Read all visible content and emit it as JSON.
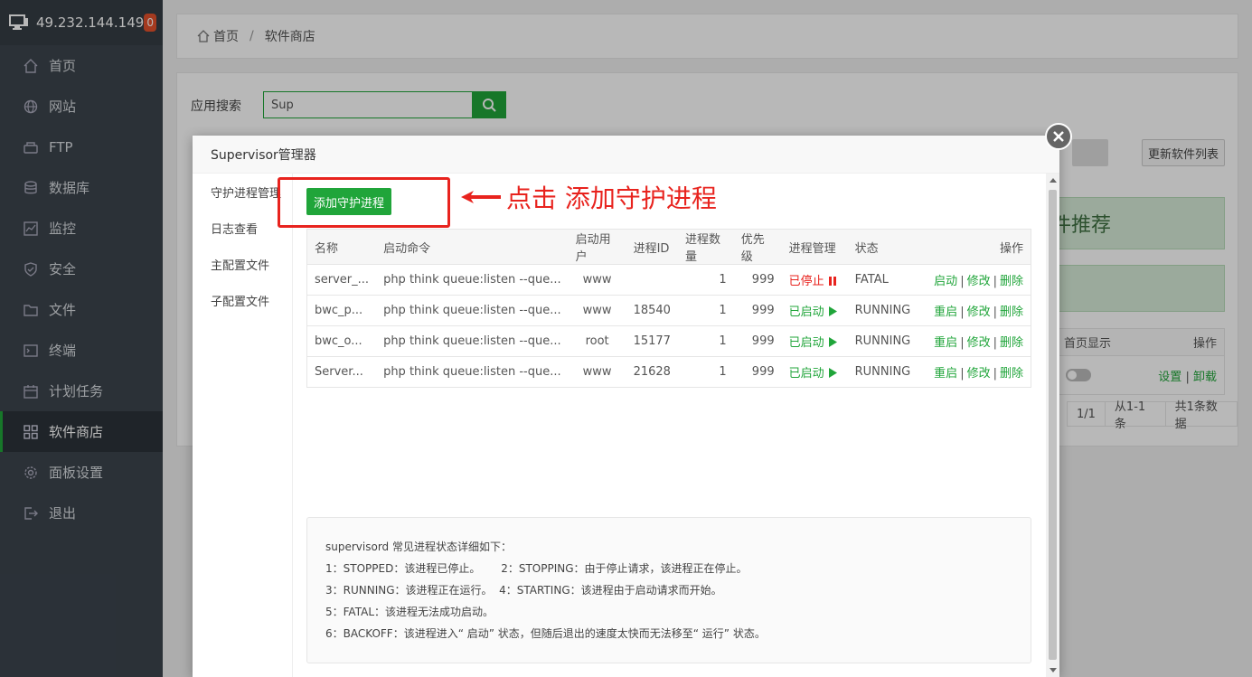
{
  "sidebar": {
    "ip": "49.232.144.149",
    "badge": "0",
    "items": [
      {
        "label": "首页",
        "icon": "home-icon"
      },
      {
        "label": "网站",
        "icon": "globe-icon"
      },
      {
        "label": "FTP",
        "icon": "ftp-icon"
      },
      {
        "label": "数据库",
        "icon": "database-icon"
      },
      {
        "label": "监控",
        "icon": "monitor-chart-icon"
      },
      {
        "label": "安全",
        "icon": "shield-icon"
      },
      {
        "label": "文件",
        "icon": "folder-icon"
      },
      {
        "label": "终端",
        "icon": "terminal-icon"
      },
      {
        "label": "计划任务",
        "icon": "calendar-icon"
      },
      {
        "label": "软件商店",
        "icon": "grid-icon"
      },
      {
        "label": "面板设置",
        "icon": "gear-icon"
      },
      {
        "label": "退出",
        "icon": "logout-icon"
      }
    ],
    "active_index": 9
  },
  "breadcrumb": {
    "home": "首页",
    "separator": "/",
    "current": "软件商店"
  },
  "store": {
    "search_label": "应用搜索",
    "search_value": "Sup",
    "refresh_label": "更新软件列表",
    "recommend_text": "件推荐",
    "table_header_home": "首页显示",
    "table_header_ops": "操作",
    "row_ops_set": "设置",
    "row_ops_uninstall": "卸载",
    "pager_page": "1/1",
    "pager_range": "从1-1条",
    "pager_total": "共1条数据"
  },
  "modal": {
    "title": "Supervisor管理器",
    "tabs": [
      "守护进程管理",
      "日志查看",
      "主配置文件",
      "子配置文件"
    ],
    "add_button": "添加守护进程",
    "annotation": "点击 添加守护进程",
    "columns": [
      "名称",
      "启动命令",
      "启动用户",
      "进程ID",
      "进程数量",
      "优先级",
      "进程管理",
      "状态",
      "操作"
    ],
    "rows": [
      {
        "name": "server_...",
        "cmd": "php think queue:listen --que...",
        "user": "www",
        "pid": "",
        "count": "1",
        "priority": "999",
        "manage": "已停止",
        "manage_state": "stopped",
        "status": "FATAL",
        "op1": "启动",
        "op2": "修改",
        "op3": "删除"
      },
      {
        "name": "bwc_p...",
        "cmd": "php think queue:listen --que...",
        "user": "www",
        "pid": "18540",
        "count": "1",
        "priority": "999",
        "manage": "已启动",
        "manage_state": "started",
        "status": "RUNNING",
        "op1": "重启",
        "op2": "修改",
        "op3": "删除"
      },
      {
        "name": "bwc_o...",
        "cmd": "php think queue:listen --que...",
        "user": "root",
        "pid": "15177",
        "count": "1",
        "priority": "999",
        "manage": "已启动",
        "manage_state": "started",
        "status": "RUNNING",
        "op1": "重启",
        "op2": "修改",
        "op3": "删除"
      },
      {
        "name": "Server...",
        "cmd": "php think queue:listen --que...",
        "user": "www",
        "pid": "21628",
        "count": "1",
        "priority": "999",
        "manage": "已启动",
        "manage_state": "started",
        "status": "RUNNING",
        "op1": "重启",
        "op2": "修改",
        "op3": "删除"
      }
    ],
    "info": {
      "title": "supervisord 常见进程状态详细如下：",
      "lines": [
        "1：STOPPED：该进程已停止。      2：STOPPING：由于停止请求，该进程正在停止。",
        "3：RUNNING：该进程正在运行。  4：STARTING：该进程由于启动请求而开始。",
        "5：FATAL：该进程无法成功启动。",
        "6：BACKOFF：该进程进入“ 启动” 状态，但随后退出的速度太快而无法移至“ 运行” 状态。"
      ]
    }
  },
  "colors": {
    "accent": "#20a53a",
    "danger": "#e8231e",
    "sidebar": "#3c444d"
  }
}
